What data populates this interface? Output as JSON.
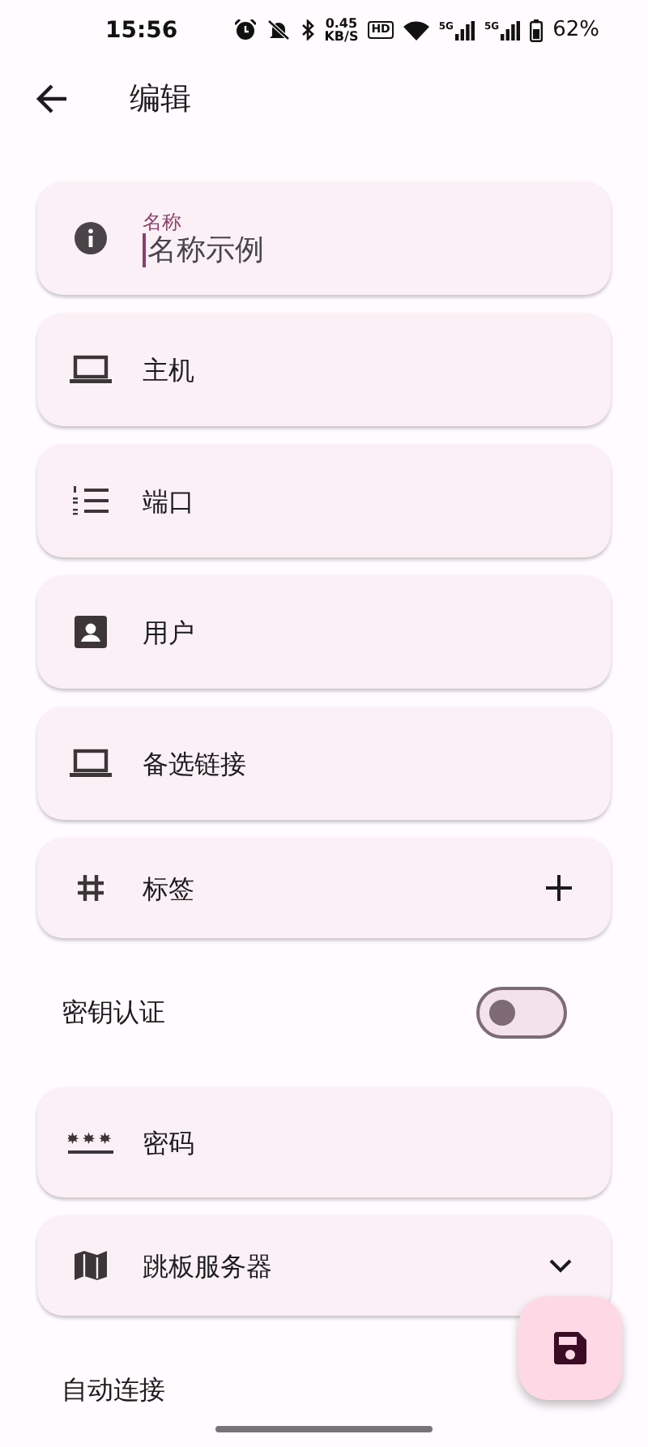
{
  "status_bar": {
    "time": "15:56",
    "speed_value": "0.45",
    "speed_unit": "KB/S",
    "hd": "HD",
    "signals": [
      "5G",
      "5G"
    ],
    "battery": "62%"
  },
  "header": {
    "title": "编辑"
  },
  "fields": [
    {
      "kind": "text",
      "label": "名称",
      "value": "名称示例",
      "focused": true
    },
    {
      "kind": "text",
      "placeholder": "主机"
    },
    {
      "kind": "text",
      "placeholder": "端口"
    },
    {
      "kind": "text",
      "placeholder": "用户"
    },
    {
      "kind": "text",
      "placeholder": "备选链接"
    },
    {
      "kind": "tags",
      "placeholder": "标签"
    },
    {
      "kind": "switch",
      "label": "密钥认证",
      "on": false
    },
    {
      "kind": "text",
      "placeholder": "密码"
    },
    {
      "kind": "dropdown",
      "placeholder": "跳板服务器"
    },
    {
      "kind": "label",
      "label": "自动连接"
    }
  ]
}
